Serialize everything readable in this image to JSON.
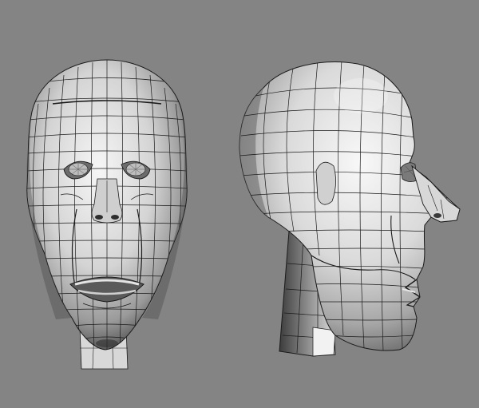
{
  "scene": {
    "background_color": "#848484",
    "shading": {
      "light": "#f4f4f4",
      "mid": "#c8c8c8",
      "dark": "#7a7a7a",
      "shadow": "#3e3e3e",
      "wire": "#1a1a1a"
    },
    "models": [
      {
        "name": "head-front-view",
        "view": "front"
      },
      {
        "name": "head-side-view",
        "view": "profile-right"
      }
    ]
  }
}
